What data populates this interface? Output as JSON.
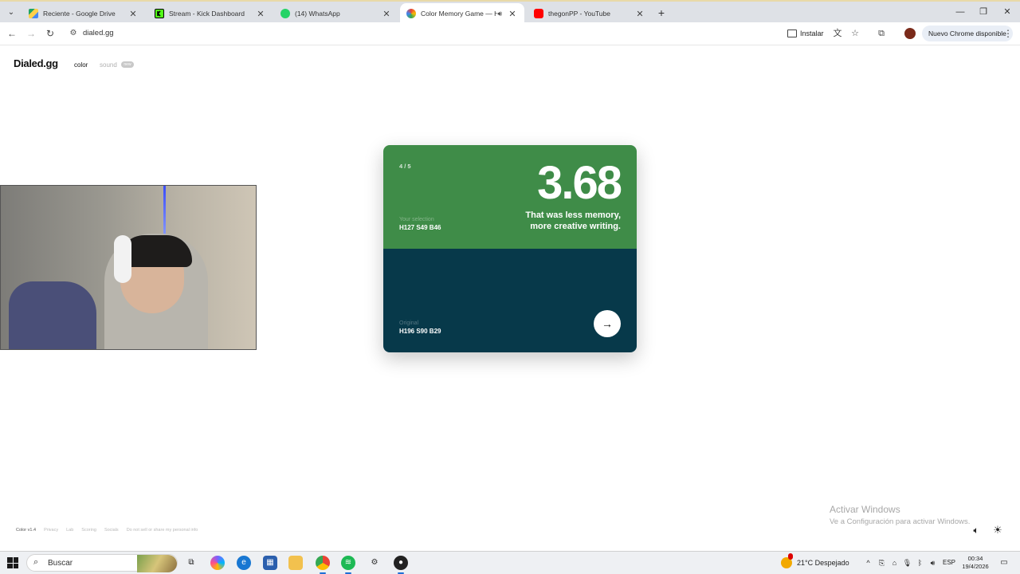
{
  "browser": {
    "tabs": [
      {
        "title": "Reciente - Google Drive",
        "color": "#1fa463"
      },
      {
        "title": "Stream - Kick Dashboard",
        "color": "#53fc18"
      },
      {
        "title": "(14) WhatsApp",
        "color": "#25d366"
      },
      {
        "title": "Color Memory Game — Hu",
        "color": "#e94335",
        "active": true
      },
      {
        "title": "thegonPP - YouTube",
        "color": "#ff0000"
      }
    ],
    "new_tab_icon": "plus-icon",
    "url": "dialed.gg",
    "install_label": "Instalar",
    "update_label": "Nuevo Chrome disponible",
    "avatar_color": "#7a2a1a"
  },
  "site": {
    "logo": "Dialed.gg",
    "mode_color": "color",
    "mode_sound": "sound",
    "soon_badge": "new",
    "footer": {
      "version": "Color v1.4",
      "links": [
        "Privacy",
        "Lab",
        "Scoring",
        "Socials",
        "Do not sell or share my personal info"
      ]
    }
  },
  "game": {
    "round": "4 / 5",
    "score": "3.68",
    "quip_line1": "That was less memory,",
    "quip_line2": "more creative writing.",
    "selection_label": "Your selection",
    "selection_value": "H127 S49 B46",
    "selection_color": "#3f8c48",
    "original_label": "Original",
    "original_value": "H196 S90 B29",
    "original_color": "#07394a",
    "next_icon": "arrow-right-icon"
  },
  "watermark": {
    "title": "Activar Windows",
    "subtitle": "Ve a Configuración para activar Windows."
  },
  "taskbar": {
    "search_placeholder": "Buscar",
    "weather": "21°C  Despejado",
    "language": "ESP",
    "time": "00:34",
    "date": "19/4/2026"
  }
}
